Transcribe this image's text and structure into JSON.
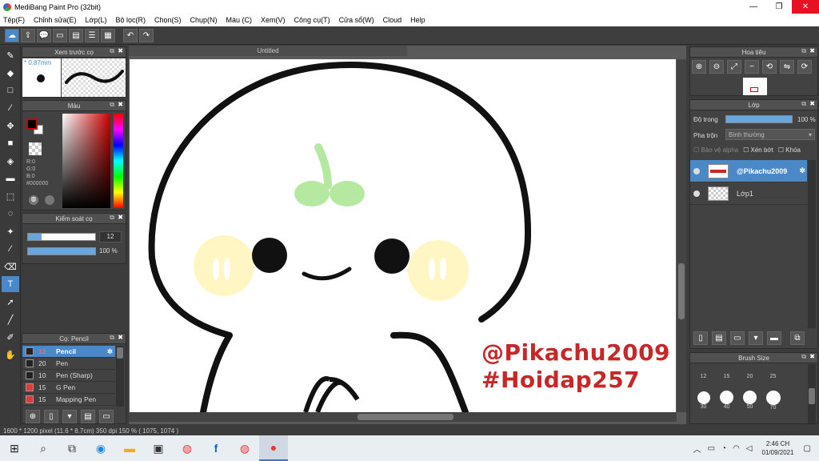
{
  "window": {
    "title": "MediBang Paint Pro (32bit)",
    "minimize": "—",
    "maximize": "❐",
    "close": "✕"
  },
  "menu": [
    "Tệp(F)",
    "Chỉnh sửa(E)",
    "Lớp(L)",
    "Bộ lọc(R)",
    "Chọn(S)",
    "Chụp(N)",
    "Màu (C)",
    "Xem(V)",
    "Công cụ(T)",
    "Cửa sổ(W)",
    "Cloud",
    "Help"
  ],
  "document": {
    "tab_title": "Untitled"
  },
  "watermark": {
    "line1": "@Pikachu2009",
    "line2": "#Hoidap257"
  },
  "brush_preview": {
    "title": "Xem trước cọ",
    "size": "0.87mm"
  },
  "color_panel": {
    "title": "Màu",
    "r": "R:0",
    "g": "G:0",
    "b": "B:0",
    "hex": "#000000",
    "primary": "#000000",
    "secondary": "#ffffff",
    "accent": "#cc0000"
  },
  "brush_control": {
    "title": "Kiểm soát cọ",
    "size_value": "12",
    "opacity_value": "100 %"
  },
  "brush_list": {
    "title": "Cọ: Pencil",
    "items": [
      {
        "size": "12",
        "name": "Pencil",
        "color": "#222222",
        "selected": true
      },
      {
        "size": "20",
        "name": "Pen",
        "color": "#222222",
        "selected": false
      },
      {
        "size": "10",
        "name": "Pen (Sharp)",
        "color": "#222222",
        "selected": false
      },
      {
        "size": "15",
        "name": "G Pen",
        "color": "#e53935",
        "selected": false
      },
      {
        "size": "15",
        "name": "Mapping Pen",
        "color": "#e53935",
        "selected": false
      }
    ]
  },
  "navigator": {
    "title": "Hoa tiêu"
  },
  "layer_panel": {
    "title": "Lớp",
    "opacity_label": "Độ trong",
    "opacity_value": "100 %",
    "blend_label": "Pha trộn",
    "blend_value": "Bình thường",
    "protect_alpha": "Bảo vệ alpha",
    "clipping": "Xén bớt",
    "lock": "Khóa",
    "layers": [
      {
        "name": "@Pikachu2009",
        "selected": true
      },
      {
        "name": "Lớp1",
        "selected": false
      }
    ]
  },
  "brush_size": {
    "title": "Brush Size",
    "sizes": [
      "12",
      "15",
      "20",
      "25",
      "30",
      "40",
      "50",
      "70"
    ]
  },
  "status": {
    "text": "1600 * 1200 pixel  (11.6 * 8.7cm)  350 dpi  150 %  ( 1075, 1074 )"
  },
  "taskbar": {
    "time": "2:46 CH",
    "date": "01/09/2021"
  }
}
